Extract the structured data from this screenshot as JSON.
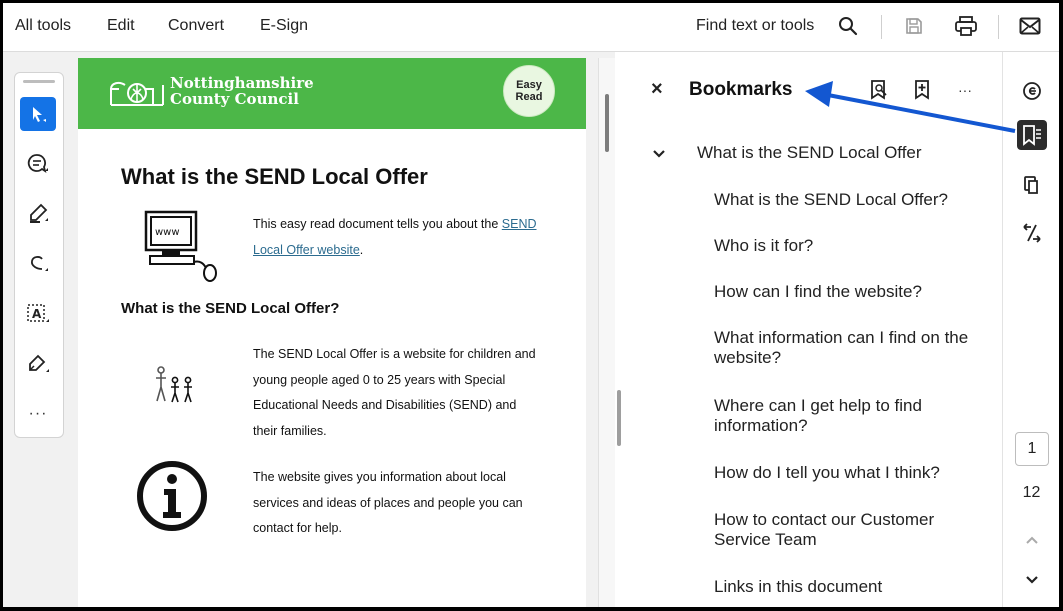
{
  "menu": {
    "all_tools": "All tools",
    "edit": "Edit",
    "convert": "Convert",
    "esign": "E-Sign"
  },
  "toolbar": {
    "find_label": "Find text or tools",
    "icons": [
      "search-icon",
      "save-icon",
      "print-icon",
      "mail-icon"
    ]
  },
  "left_tools": [
    "select-cursor-icon",
    "comment-icon",
    "highlight-pen-icon",
    "draw-freehand-icon",
    "text-select-icon",
    "sign-icon",
    "more-icon"
  ],
  "left_more_label": "···",
  "document": {
    "banner": {
      "org_line1": "Nottinghamshire",
      "org_line2": "County Council",
      "badge_line1": "Easy",
      "badge_line2": "Read"
    },
    "title": "What is the SEND Local Offer",
    "www_label": "www",
    "intro_text": "This easy read document tells you about the",
    "intro_link": "SEND Local Offer website",
    "intro_end": ".",
    "subheading": "What is the SEND Local Offer?",
    "para1": "The SEND Local Offer is a website for children and young people aged 0 to 25 years with Special Educational Needs and Disabilities (SEND) and their families.",
    "para2": "The website gives you information about local services and ideas of places and people you can contact for help."
  },
  "bookmarks": {
    "title": "Bookmarks",
    "close_label": "×",
    "more_label": "···",
    "parent": "What is the SEND Local Offer",
    "items": [
      "What is the SEND Local Offer?",
      "Who is it for?",
      "How can I find the website?",
      "What information can I find on the website?",
      "Where can I get help to find information?",
      "How do I tell you what I think?",
      "How to contact our Customer Service Team",
      "Links in this document"
    ]
  },
  "right_rail": {
    "icons": [
      "comment-panel-icon",
      "bookmark-panel-icon",
      "pages-icon",
      "compare-icon"
    ],
    "current_page": "1",
    "total_pages": "12"
  },
  "colors": {
    "accent": "#1473e6",
    "banner_green": "#4cb748",
    "arrow_blue": "#1357d1"
  }
}
